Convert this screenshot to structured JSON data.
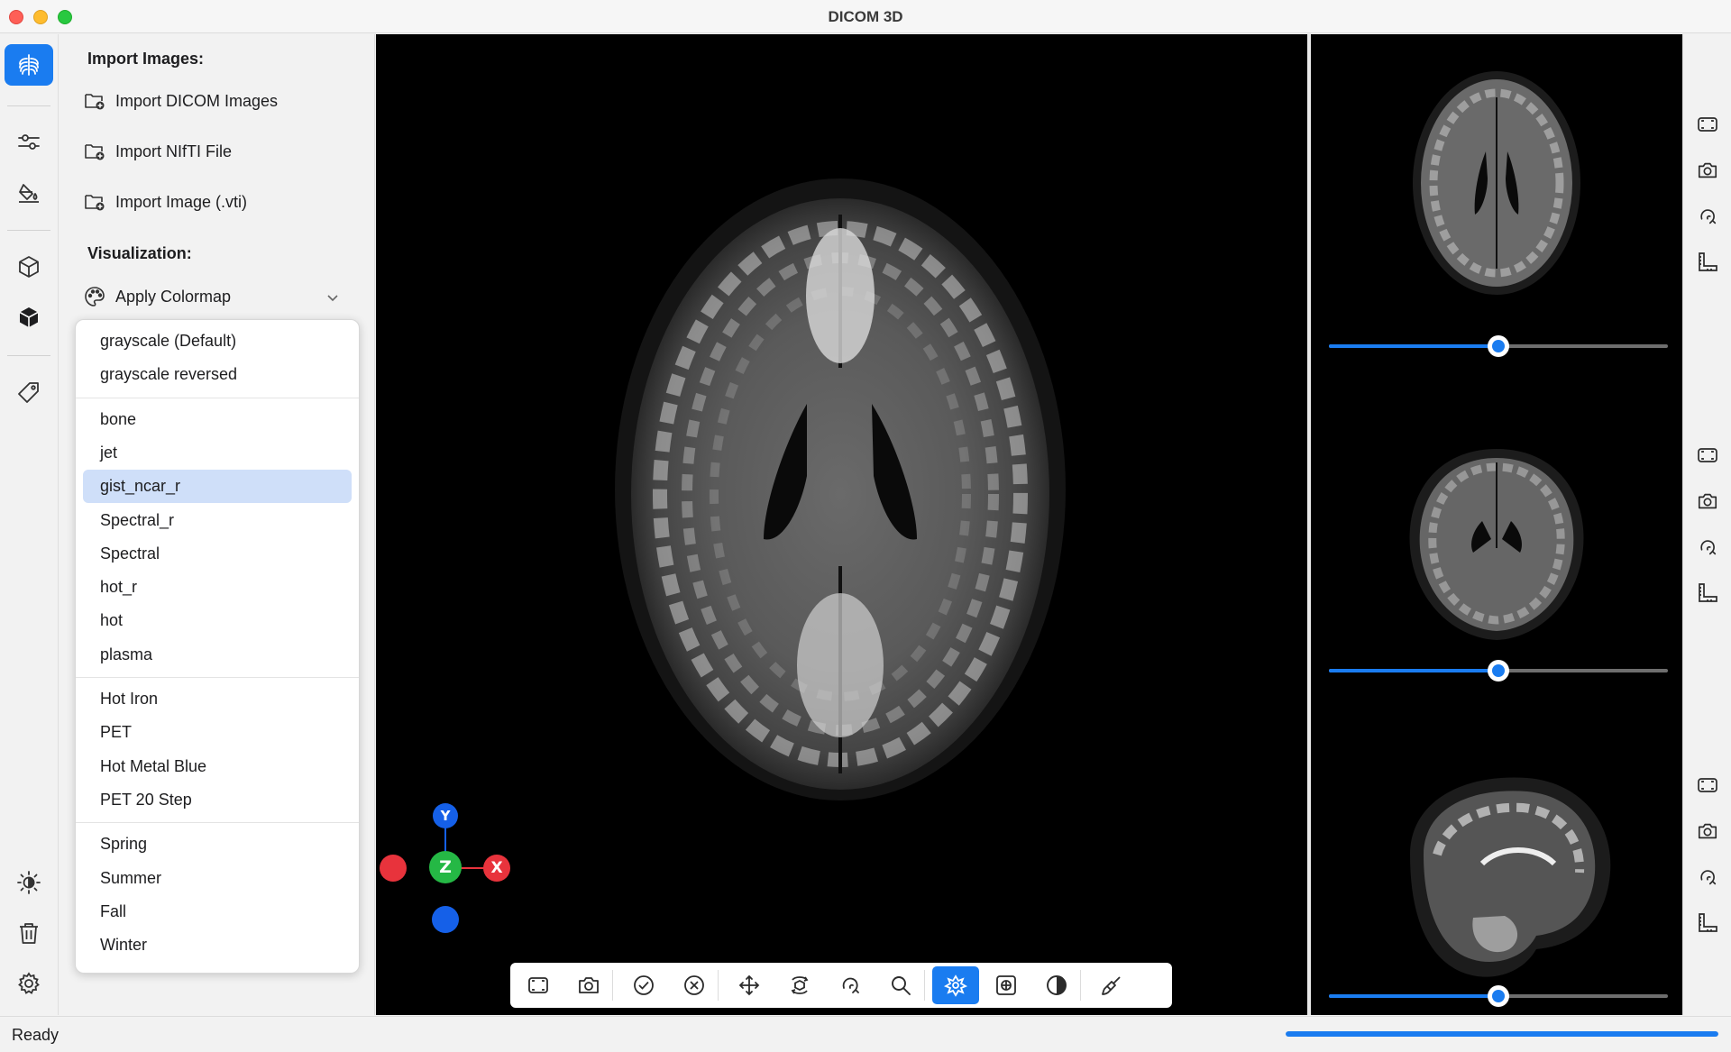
{
  "window": {
    "title": "DICOM 3D"
  },
  "rail": {
    "items": [
      {
        "icon": "ribcage-icon",
        "active": true
      },
      {
        "icon": "sliders-icon"
      },
      {
        "icon": "paint-bucket-icon"
      },
      {
        "icon": "cube-outline-icon"
      },
      {
        "icon": "cube-filled-icon"
      },
      {
        "icon": "tag-icon"
      },
      {
        "icon": "brightness-icon"
      },
      {
        "icon": "trash-icon"
      },
      {
        "icon": "gear-icon"
      }
    ]
  },
  "panel": {
    "import_title": "Import Images:",
    "import_items": [
      {
        "label": "Import DICOM Images",
        "icon": "folder-plus-icon"
      },
      {
        "label": "Import NIfTI File",
        "icon": "folder-plus-icon"
      },
      {
        "label": "Import Image (.vti)",
        "icon": "folder-plus-icon"
      }
    ],
    "visualization_title": "Visualization:",
    "colormap_label": "Apply Colormap"
  },
  "colormaps": {
    "selected": "gist_ncar_r",
    "groups": [
      [
        "grayscale (Default)",
        "grayscale reversed"
      ],
      [
        "bone",
        "jet",
        "gist_ncar_r",
        "Spectral_r",
        "Spectral",
        "hot_r",
        "hot",
        "plasma"
      ],
      [
        "Hot Iron",
        "PET",
        "Hot Metal Blue",
        "PET 20 Step"
      ],
      [
        "Spring",
        "Summer",
        "Fall",
        "Winter"
      ]
    ]
  },
  "orientation": {
    "y": "Y",
    "z": "Z",
    "x": "X"
  },
  "slices": [
    {
      "view": "axial",
      "slider_fraction": 0.5
    },
    {
      "view": "coronal",
      "slider_fraction": 0.5
    },
    {
      "view": "sagittal",
      "slider_fraction": 0.5
    }
  ],
  "toolbar": {
    "buttons": [
      "fit-view-icon",
      "camera-icon",
      "check-circle-icon",
      "x-circle-icon",
      "pan-arrows-icon",
      "rotate-3d-icon",
      "rotate-icon",
      "zoom-icon",
      "crosshair-icon",
      "grid-icon",
      "contrast-icon",
      "brush-icon"
    ],
    "active": "crosshair-icon"
  },
  "status": {
    "text": "Ready",
    "progress_fraction": 1.0
  },
  "colors": {
    "accent": "#1a7cf0",
    "x_axis": "#e8333c",
    "y_axis": "#1560e8",
    "z_axis": "#25b845"
  }
}
